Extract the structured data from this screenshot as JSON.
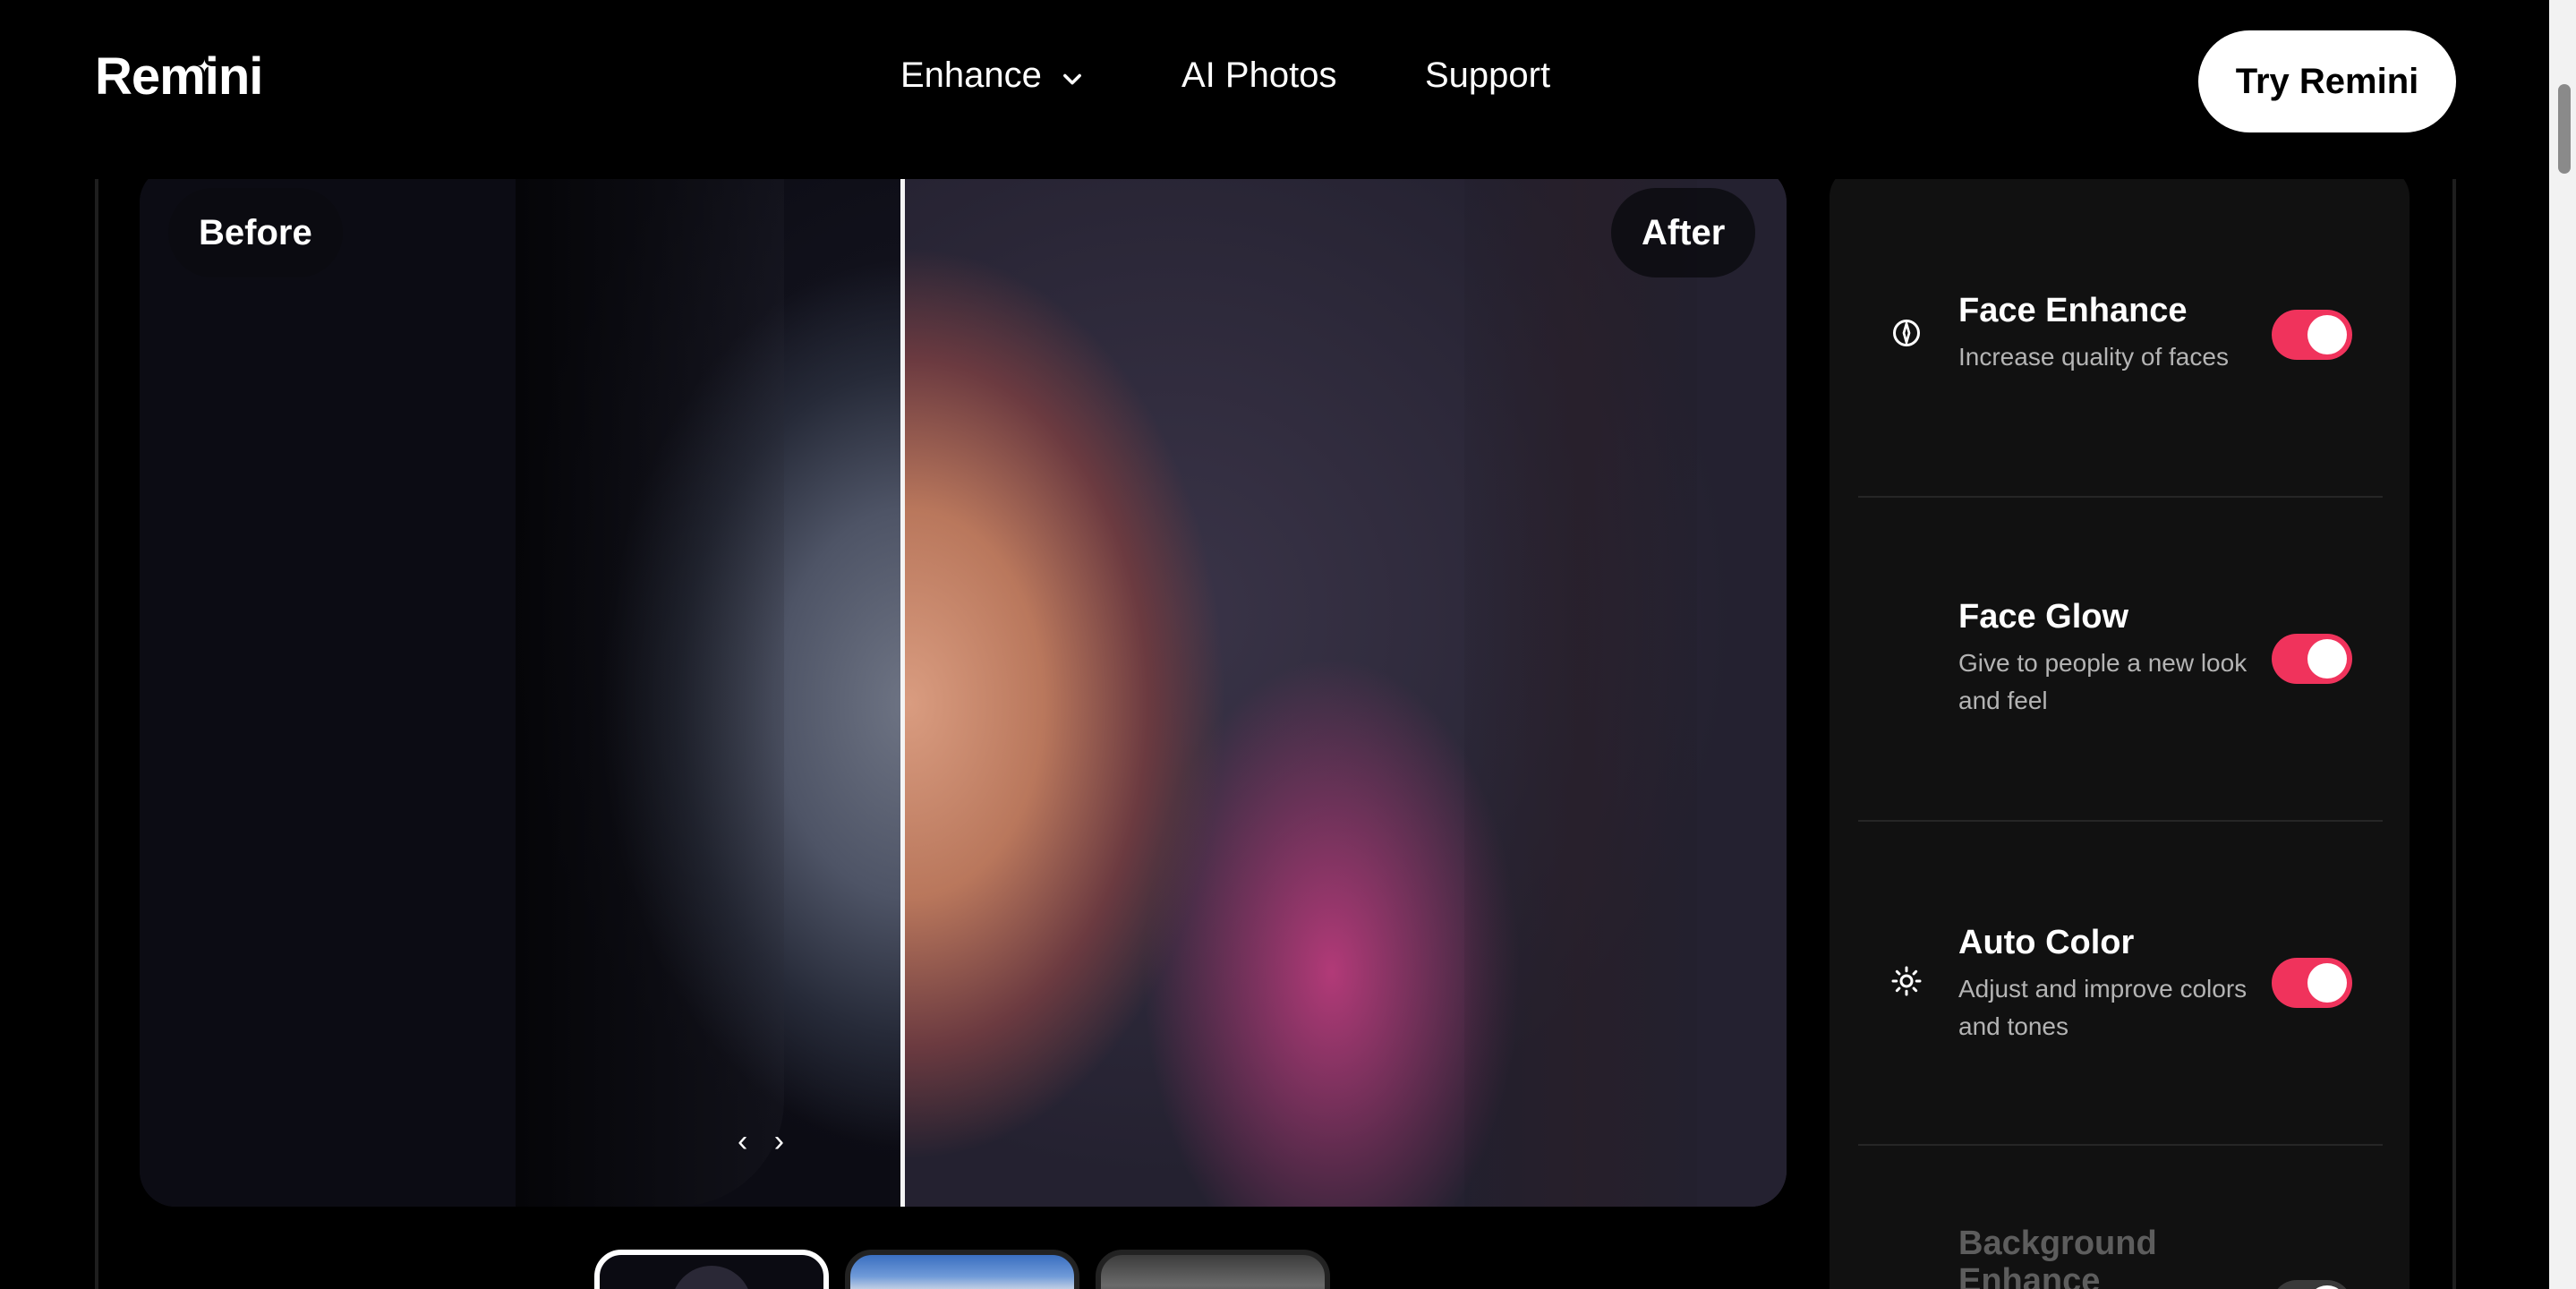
{
  "header": {
    "logo": "Remini",
    "nav": {
      "enhance": "Enhance",
      "ai_photos": "AI Photos",
      "support": "Support"
    },
    "cta": "Try Remini"
  },
  "compare": {
    "before_label": "Before",
    "after_label": "After"
  },
  "features": [
    {
      "title": "Face Enhance",
      "desc": "Increase quality of faces",
      "icon": "face-enhance-icon",
      "enabled": true
    },
    {
      "title": "Face Glow",
      "desc": "Give to people a new look and feel",
      "icon": "",
      "enabled": true
    },
    {
      "title": "Auto Color",
      "desc": "Adjust and improve colors and tones",
      "icon": "sun-icon",
      "enabled": true
    },
    {
      "title": "Background Enhance",
      "desc": "",
      "icon": "",
      "enabled": false
    }
  ],
  "colors": {
    "accent": "#f0335c",
    "panel": "#111111",
    "background": "#000000"
  }
}
